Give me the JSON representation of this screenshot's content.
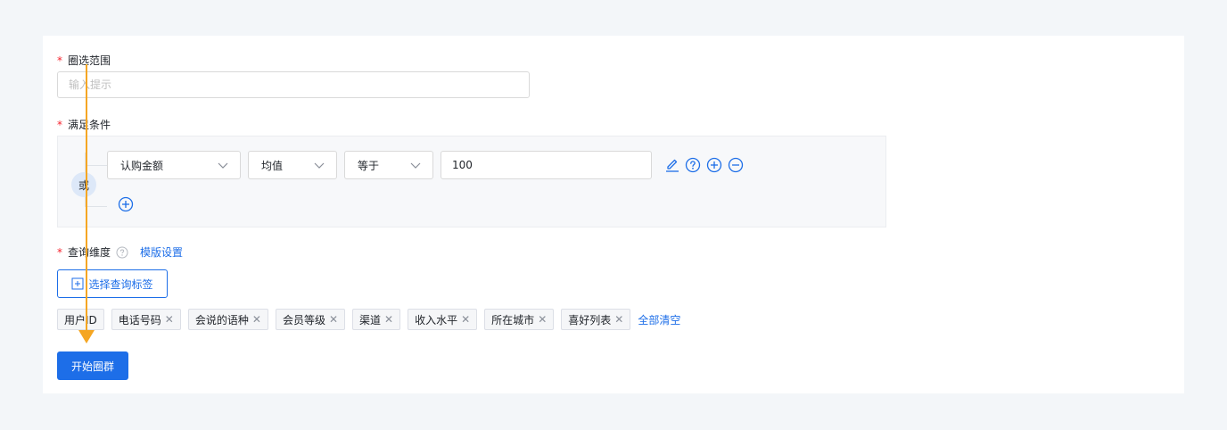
{
  "form": {
    "scope": {
      "label": "圈选范围",
      "required_mark": "*",
      "placeholder": "输入提示"
    },
    "conditions": {
      "label": "满足条件",
      "required_mark": "*",
      "logic": "或",
      "row": {
        "field": "认购金额",
        "aggregation": "均值",
        "operator": "等于",
        "value": "100"
      }
    },
    "dimension": {
      "label": "查询维度",
      "required_mark": "*",
      "template_link": "模版设置",
      "select_button": "选择查询标签",
      "tags": [
        {
          "label": "用户ID",
          "removable": false
        },
        {
          "label": "电话号码",
          "removable": true
        },
        {
          "label": "会说的语种",
          "removable": true
        },
        {
          "label": "会员等级",
          "removable": true
        },
        {
          "label": "渠道",
          "removable": true
        },
        {
          "label": "收入水平",
          "removable": true
        },
        {
          "label": "所在城市",
          "removable": true
        },
        {
          "label": "喜好列表",
          "removable": true
        }
      ],
      "clear_all": "全部清空"
    },
    "submit": "开始圈群"
  },
  "colors": {
    "primary": "#1d6ee8",
    "required": "#f5222d",
    "annotation": "#f5a623",
    "page_bg": "#f3f6f9"
  }
}
